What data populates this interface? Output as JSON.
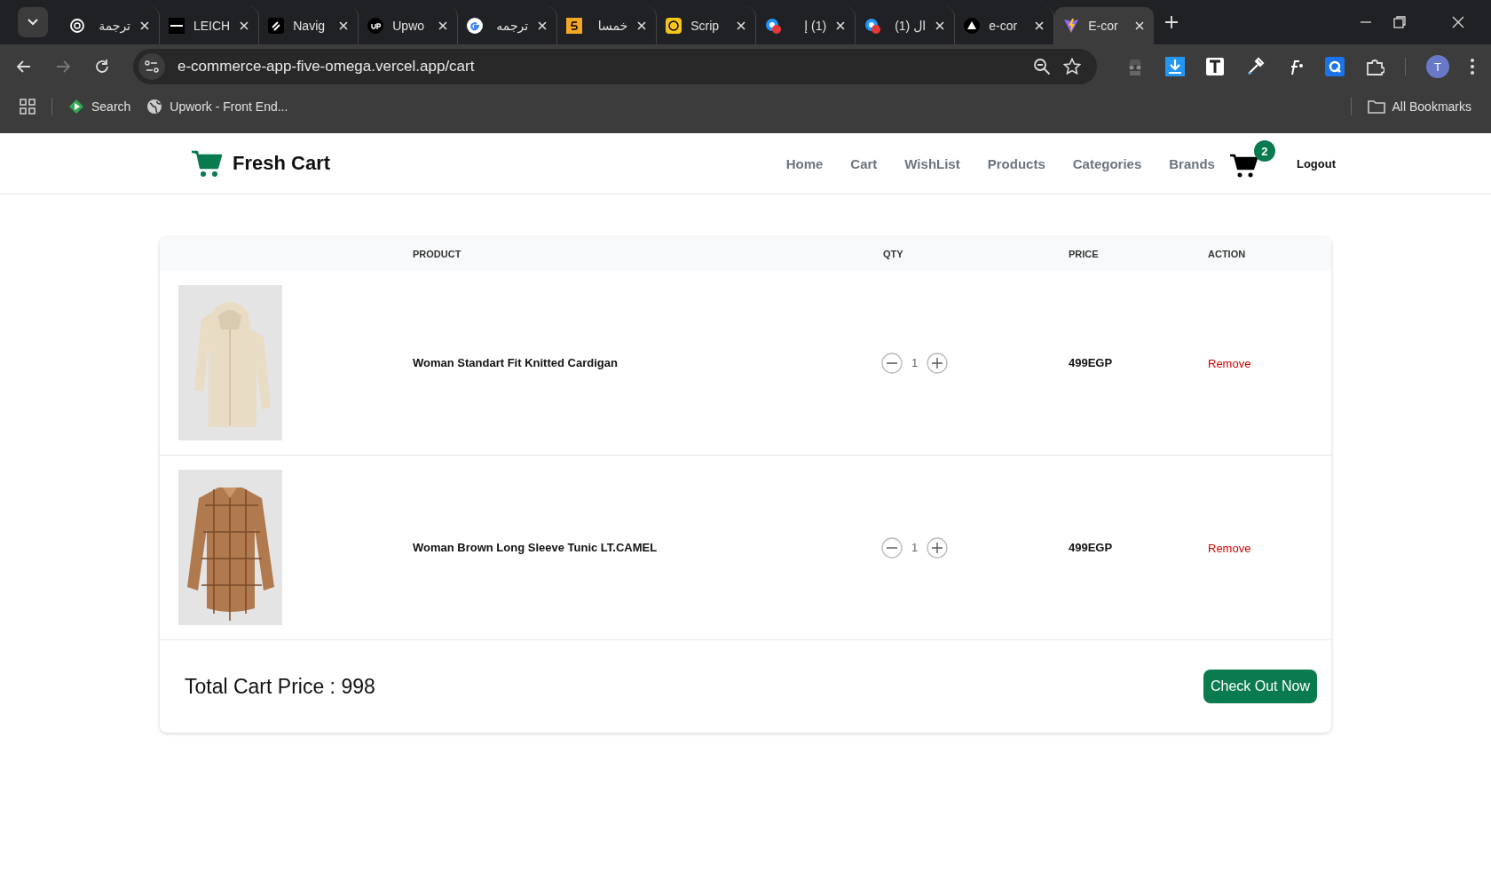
{
  "browser": {
    "tabs": [
      {
        "title": "ترجمة",
        "selected": false
      },
      {
        "title": "LEICH",
        "selected": false
      },
      {
        "title": "Navig",
        "selected": false
      },
      {
        "title": "Upwo",
        "selected": false
      },
      {
        "title": "ترجمه",
        "selected": false
      },
      {
        "title": "خمسا",
        "selected": false
      },
      {
        "title": "Scrip",
        "selected": false
      },
      {
        "title": "(1) إ",
        "selected": false
      },
      {
        "title": "ال (1)",
        "selected": false
      },
      {
        "title": "e-cor",
        "selected": false
      },
      {
        "title": "E-cor",
        "selected": true
      }
    ],
    "url": "e-commerce-app-five-omega.vercel.app/cart",
    "profile": "T",
    "bookmarks": [
      {
        "label": "Search"
      },
      {
        "label": "Upwork - Front End..."
      }
    ],
    "all_bookmarks": "All Bookmarks"
  },
  "navbar": {
    "brand": "Fresh Cart",
    "links": [
      "Home",
      "Cart",
      "WishList",
      "Products",
      "Categories",
      "Brands"
    ],
    "cart_count": "2",
    "logout": "Logout"
  },
  "table": {
    "columns": [
      "PRODUCT",
      "QTY",
      "PRICE",
      "ACTION"
    ],
    "rows": [
      {
        "kind": "picture",
        "name": "Woman Standart Fit Knitted Cardigan",
        "qty": "1",
        "price": "499EGP",
        "action": "Remove"
      },
      {
        "kind": "picture",
        "name": "Woman Brown Long Sleeve Tunic LT.CAMEL",
        "qty": "1",
        "price": "499EGP",
        "action": "Remove"
      }
    ]
  },
  "total": "Total Cart Price : 998",
  "checkout": "Check Out Now"
}
